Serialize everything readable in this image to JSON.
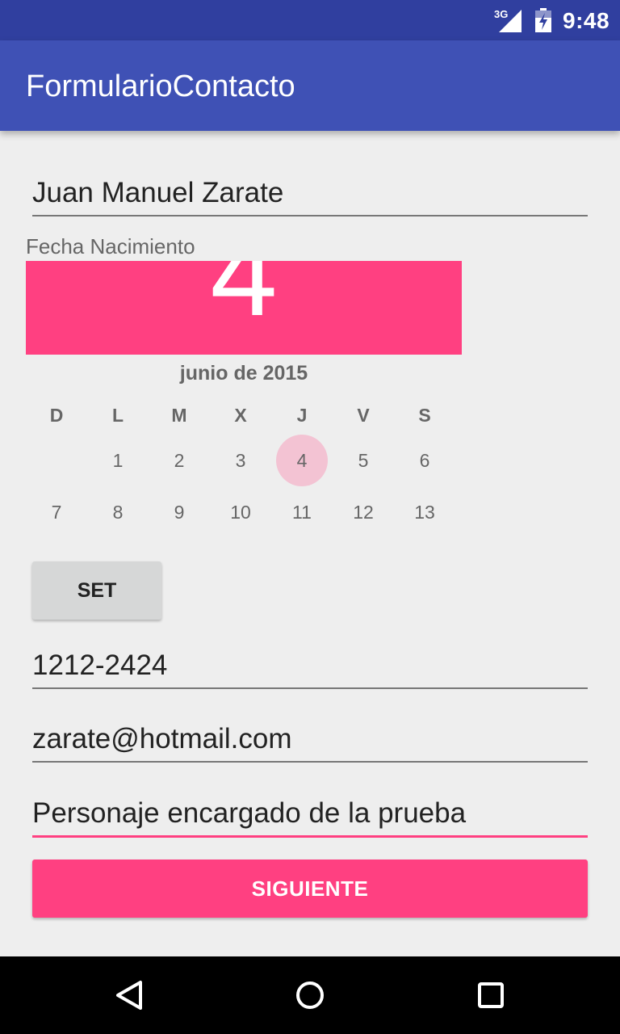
{
  "status_bar": {
    "network": "3G",
    "time": "9:48"
  },
  "app_bar": {
    "title": "FormularioContacto"
  },
  "form": {
    "name_value": "Juan Manuel Zarate",
    "birth_label": "Fecha Nacimiento",
    "phone_value": "1212-2424",
    "email_value": "zarate@hotmail.com",
    "description_value": "Personaje encargado de la prueba",
    "set_label": "SET",
    "next_label": "SIGUIENTE"
  },
  "date_picker": {
    "selected_day": "4",
    "month_year": "junio de 2015",
    "weekdays": [
      "D",
      "L",
      "M",
      "X",
      "J",
      "V",
      "S"
    ],
    "weeks": [
      [
        "",
        "1",
        "2",
        "3",
        "4",
        "5",
        "6"
      ],
      [
        "7",
        "8",
        "9",
        "10",
        "11",
        "12",
        "13"
      ]
    ]
  },
  "colors": {
    "primary": "#3f51b5",
    "primary_dark": "#303f9f",
    "accent": "#ff4081"
  },
  "icons": {
    "signal": "signal-icon",
    "battery": "battery-charging-icon",
    "back": "back-icon",
    "home": "home-icon",
    "recents": "recents-icon"
  }
}
